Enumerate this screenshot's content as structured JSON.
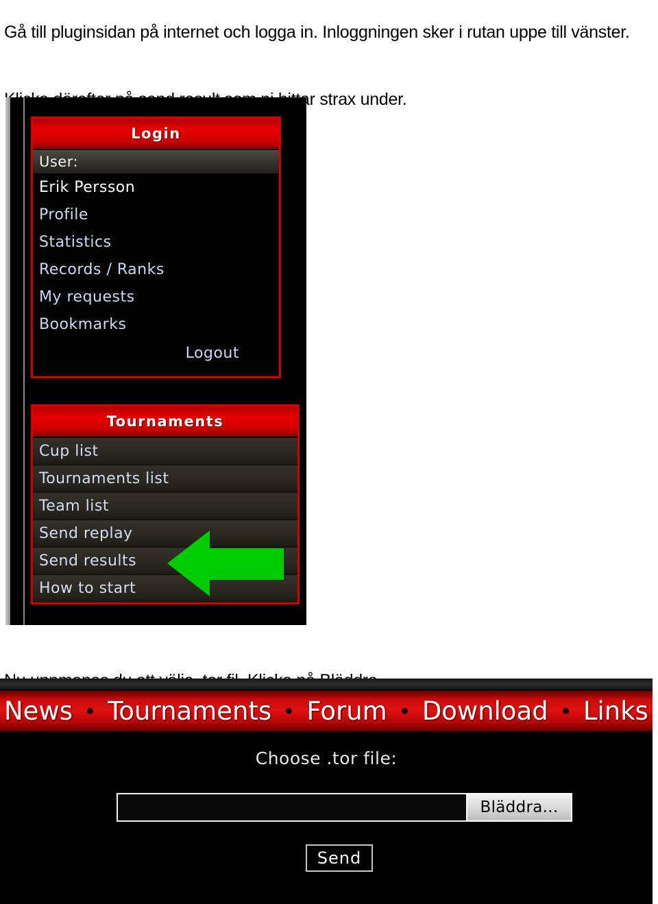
{
  "document": {
    "paragraph_1": "Gå till pluginsidan på internet och logga in. Inloggningen sker i rutan uppe till vänster.",
    "paragraph_2": "Klicka därefter på send result som ni hittar strax under.",
    "paragraph_3": "Nu uppmanas du att välja .tor fil. Klicka på Bläddra…"
  },
  "screenshot_sidebar": {
    "login_panel": {
      "header": "Login",
      "user_label": "User:",
      "username": "Erik Persson",
      "links": [
        "Profile",
        "Statistics",
        "Records / Ranks",
        "My requests",
        "Bookmarks"
      ],
      "logout": "Logout"
    },
    "tournaments_panel": {
      "header": "Tournaments",
      "items": [
        "Cup list",
        "Tournaments list",
        "Team list",
        "Send replay",
        "Send results",
        "How to start"
      ]
    },
    "annotation": {
      "icon": "green-left-arrow",
      "color": "#00cc00",
      "points_at": "Send results"
    }
  },
  "screenshot_upload": {
    "nav": [
      "News",
      "Tournaments",
      "Forum",
      "Download",
      "Links"
    ],
    "form": {
      "label": "Choose .tor file:",
      "file_value": "",
      "browse_label": "Bläddra...",
      "send_label": "Send"
    }
  },
  "colors": {
    "accent_red": "#d60000",
    "panel_black": "#050505",
    "arrow_green": "#00cc00",
    "link_blue": "#cdd8f2"
  }
}
